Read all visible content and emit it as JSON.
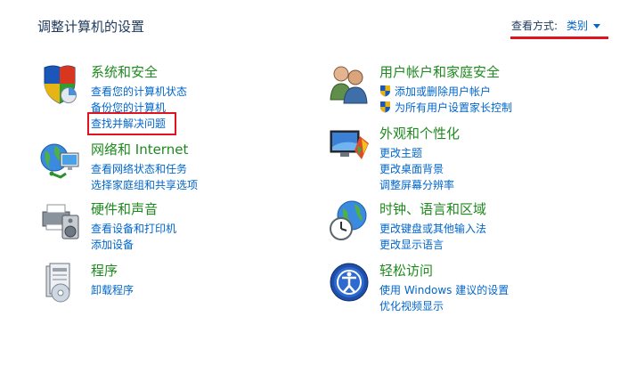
{
  "title": "调整计算机的设置",
  "view_by": {
    "label": "查看方式:",
    "value": "类别"
  },
  "left_categories": [
    {
      "title": "系统和安全",
      "links": [
        "查看您的计算机状态",
        "备份您的计算机",
        "查找并解决问题"
      ],
      "icon": "system-security-icon"
    },
    {
      "title": "网络和 Internet",
      "links": [
        "查看网络状态和任务",
        "选择家庭组和共享选项"
      ],
      "icon": "network-icon"
    },
    {
      "title": "硬件和声音",
      "links": [
        "查看设备和打印机",
        "添加设备"
      ],
      "icon": "hardware-sound-icon"
    },
    {
      "title": "程序",
      "links": [
        "卸载程序"
      ],
      "icon": "programs-icon"
    }
  ],
  "right_categories": [
    {
      "title": "用户帐户和家庭安全",
      "links": [
        "添加或删除用户帐户",
        "为所有用户设置家长控制"
      ],
      "icon": "user-accounts-icon"
    },
    {
      "title": "外观和个性化",
      "links": [
        "更改主题",
        "更改桌面背景",
        "调整屏幕分辨率"
      ],
      "icon": "appearance-icon"
    },
    {
      "title": "时钟、语言和区域",
      "links": [
        "更改键盘或其他输入法",
        "更改显示语言"
      ],
      "icon": "clock-language-icon"
    },
    {
      "title": "轻松访问",
      "links": [
        "使用 Windows 建议的设置",
        "优化视频显示"
      ],
      "icon": "ease-of-access-icon"
    }
  ],
  "colors": {
    "heading": "#1e8a1e",
    "link": "#0066cc",
    "title": "#1e395b",
    "highlight": "#e0131f"
  }
}
